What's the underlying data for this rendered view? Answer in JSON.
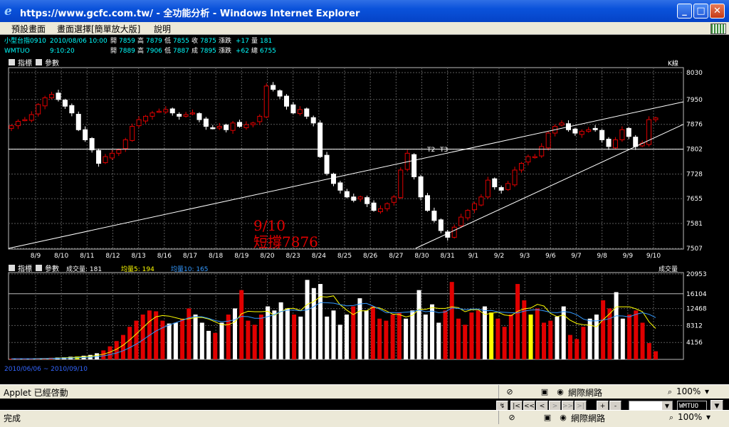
{
  "window": {
    "title": "https://www.gcfc.com.tw/ - 全功能分析 - Windows Internet Explorer",
    "minimize": "_",
    "maximize": "□",
    "close": "✕"
  },
  "menu": [
    "預設畫面",
    "畫面選擇[簡單放大版]",
    "說明"
  ],
  "quote": {
    "row1": {
      "name": "小型台指0910",
      "datetime": "2010/08/06 10:00",
      "open_label": "開",
      "open": "7859",
      "high_label": "高",
      "high": "7879",
      "low_label": "低",
      "low": "7855",
      "close_label": "收",
      "close": "7875",
      "change_label": "漲跌",
      "change": "+17",
      "vol_label": "量",
      "volume": "181"
    },
    "row2": {
      "name": "WMTUO",
      "time": "9:10:20",
      "open_label": "開",
      "open": "7889",
      "high_label": "高",
      "high": "7906",
      "low_label": "低",
      "low": "7887",
      "last_label": "成",
      "last": "7895",
      "change_label": "漲跌",
      "change": "+62",
      "vol_label": "總",
      "volume": "6755"
    }
  },
  "price_panel": {
    "indicator_btn": "指標",
    "param_btn": "參數",
    "chart_type": "K線"
  },
  "volume_panel": {
    "indicator_btn": "指標",
    "param_btn": "參數",
    "vol_text": "成交量: 181",
    "ma5_text": "均量5: 194",
    "ma10_text": "均量10: 165",
    "label": "成交量"
  },
  "date_range": "2010/06/06 ~ 2010/09/10",
  "annotation": {
    "line1": "9/10",
    "line2": "短撐7876"
  },
  "point_labels": [
    "T2",
    "T3"
  ],
  "nav_buttons": [
    "↯",
    "|<",
    "<<",
    "<",
    ">",
    ">>",
    ">|",
    "+",
    "-"
  ],
  "symbol_input": "WMTUO",
  "status_app": {
    "text": "Applet 已經啓動",
    "zone": "網際網路",
    "zoom": "100%"
  },
  "status_ie": {
    "text": "完成",
    "zone": "網際網路",
    "zoom": "100%"
  },
  "colors": {
    "up": "#e00000",
    "down": "#ffffff",
    "yellow": "#ffff00",
    "ma5": "#ffff00",
    "ma10": "#3399ff",
    "grid": "#5a5a5a",
    "quote_text": "#00ffff",
    "annotation": "#e00000"
  },
  "chart_data": [
    {
      "type": "candlestick",
      "x_ticks": [
        "8/9",
        "8/10",
        "8/11",
        "8/12",
        "8/13",
        "8/16",
        "8/17",
        "8/18",
        "8/19",
        "8/20",
        "8/23",
        "8/24",
        "8/25",
        "8/26",
        "8/27",
        "8/30",
        "8/31",
        "9/1",
        "9/2",
        "9/3",
        "9/6",
        "9/7",
        "9/8",
        "9/9",
        "9/10"
      ],
      "y_ticks": [
        8030,
        7950,
        7876,
        7802,
        7728,
        7655,
        7581,
        7507
      ],
      "ylim": [
        7507,
        8030
      ],
      "horizontal_line": 7802,
      "trendlines": [
        {
          "from": [
            "start",
            7507
          ],
          "to": [
            "end",
            7943
          ]
        },
        {
          "from": [
            "8/31",
            7507
          ],
          "to": [
            "end",
            7876
          ]
        }
      ],
      "closes": [
        7872,
        7885,
        7890,
        7905,
        7935,
        7955,
        7965,
        7950,
        7930,
        7910,
        7860,
        7830,
        7800,
        7760,
        7780,
        7790,
        7800,
        7830,
        7870,
        7890,
        7900,
        7910,
        7915,
        7920,
        7910,
        7900,
        7905,
        7910,
        7890,
        7870,
        7865,
        7870,
        7860,
        7880,
        7870,
        7875,
        7880,
        7900,
        7990,
        7980,
        7960,
        7930,
        7910,
        7920,
        7900,
        7880,
        7780,
        7730,
        7700,
        7680,
        7660,
        7650,
        7660,
        7640,
        7620,
        7625,
        7640,
        7660,
        7740,
        7790,
        7720,
        7660,
        7620,
        7590,
        7560,
        7540,
        7570,
        7600,
        7620,
        7640,
        7660,
        7710,
        7690,
        7680,
        7700,
        7740,
        7760,
        7780,
        7780,
        7810,
        7850,
        7870,
        7880,
        7860,
        7850,
        7855,
        7860,
        7860,
        7830,
        7810,
        7830,
        7860,
        7840,
        7810,
        7820,
        7890,
        7895
      ]
    },
    {
      "type": "bar",
      "series": [
        {
          "name": "成交量",
          "values": [
            180,
            160,
            170,
            200,
            250,
            300,
            400,
            450,
            500,
            650,
            700,
            900,
            1100,
            1500,
            2200,
            3200,
            4500,
            6000,
            8000,
            9500,
            11000,
            12000,
            11800,
            9500,
            8800,
            9000,
            10000,
            12500,
            11000,
            9000,
            7000,
            6500,
            9000,
            11000,
            12500,
            17000,
            9500,
            8500,
            11000,
            13000,
            12000,
            14000,
            12500,
            11000,
            10500,
            19500,
            17500,
            18500,
            10500,
            12000,
            8500,
            11000,
            13000,
            15000,
            12000,
            13000,
            10000,
            9500,
            11000,
            11500,
            10000,
            12000,
            17000,
            11000,
            13500,
            9000,
            12000,
            19000,
            10000,
            8500,
            11500,
            12000,
            13000,
            11500,
            10000,
            8000,
            11000,
            18500,
            14500,
            11000,
            12500,
            9000,
            9500,
            10500,
            13000,
            6000,
            5000,
            8000,
            10000,
            11000,
            14500,
            12500,
            16500,
            10000,
            11000,
            12000,
            9000,
            4000,
            2000
          ]
        },
        {
          "name": "均量5",
          "values": []
        },
        {
          "name": "均量10",
          "values": []
        }
      ],
      "y_ticks": [
        20953,
        16104,
        12468,
        8312,
        4156
      ],
      "ylim": [
        0,
        20953
      ]
    }
  ]
}
